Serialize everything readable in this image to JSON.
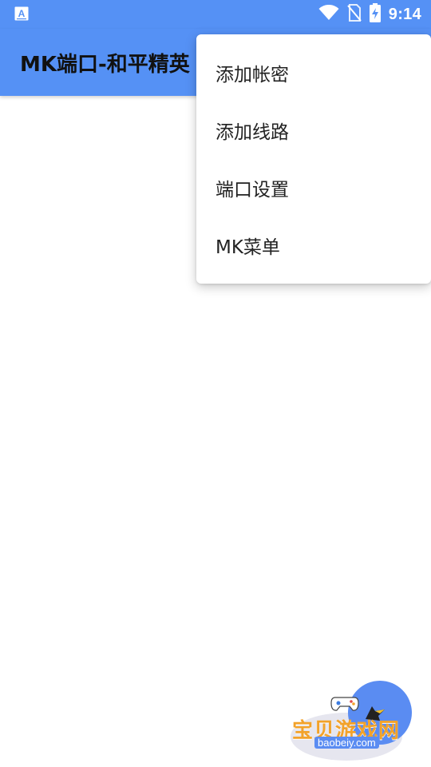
{
  "status_bar": {
    "time": "9:14",
    "left_icon": "accessibility-a-icon",
    "icons": [
      "wifi-icon",
      "no-sim-icon",
      "battery-charging-icon"
    ]
  },
  "app_bar": {
    "title": "MK端口-和平精英",
    "background": "#5591f5"
  },
  "menu": {
    "items": [
      {
        "label": "添加帐密"
      },
      {
        "label": "添加线路"
      },
      {
        "label": "端口设置"
      },
      {
        "label": "MK菜单"
      }
    ]
  },
  "watermark": {
    "text": "宝贝游戏网",
    "subtext": "baobeiy.com"
  }
}
